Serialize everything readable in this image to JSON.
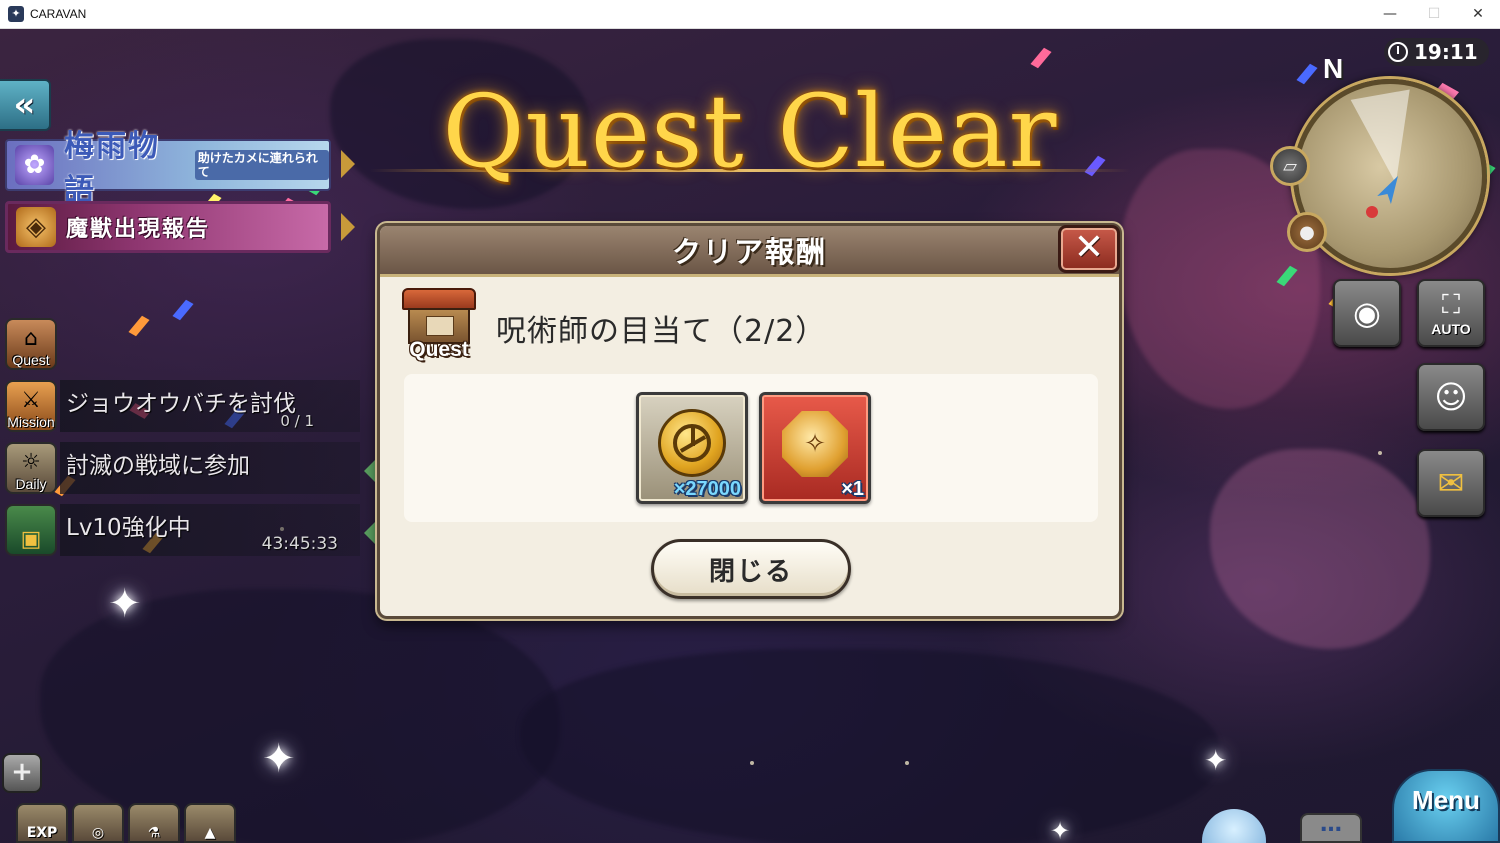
{
  "window": {
    "title": "CARAVAN",
    "minimize": "—",
    "maximize": "☐",
    "close": "✕"
  },
  "hud": {
    "clock": "19:11",
    "compass_north": "N",
    "back_icon": "«"
  },
  "banner": {
    "title": "Quest Clear"
  },
  "events": [
    {
      "title": "梅雨物語",
      "subtitle": "助けたカメに連れられて",
      "icon": "star-flower-icon"
    },
    {
      "title": "魔獣出現報告",
      "icon": "fox-mask-icon"
    }
  ],
  "side_labels": {
    "quest": "Quest",
    "mission": "Mission",
    "daily": "Daily"
  },
  "tasks": {
    "mission": {
      "text": "ジョウオウバチを討伐",
      "progress": "0 / 1"
    },
    "daily": {
      "text": "討滅の戦域に参加"
    },
    "upgrade": {
      "text": "Lv10強化中",
      "timer": "43:45:33"
    }
  },
  "right_buttons": {
    "auto_label": "AUTO"
  },
  "bottom": {
    "exp_label": "EXP",
    "menu_label": "Menu",
    "chat_label": "…"
  },
  "dialog": {
    "title": "クリア報酬",
    "close_x": "✕",
    "quest_badge_label": "Quest",
    "quest_name": "呪術師の目当て（2/2）",
    "rewards": [
      {
        "item": "gold-coin",
        "quantity": "×27000"
      },
      {
        "item": "enhancement-crystal",
        "quantity": "×1"
      }
    ],
    "close_button_label": "閉じる"
  },
  "colors": {
    "title_gold": "#ffd64a",
    "dialog_bg": "#f3eee2",
    "dialog_header": "#7d6856",
    "close_x_red": "#a83a2c",
    "reward_red": "#c83a2e",
    "back_button_teal": "#3f8ea4"
  }
}
